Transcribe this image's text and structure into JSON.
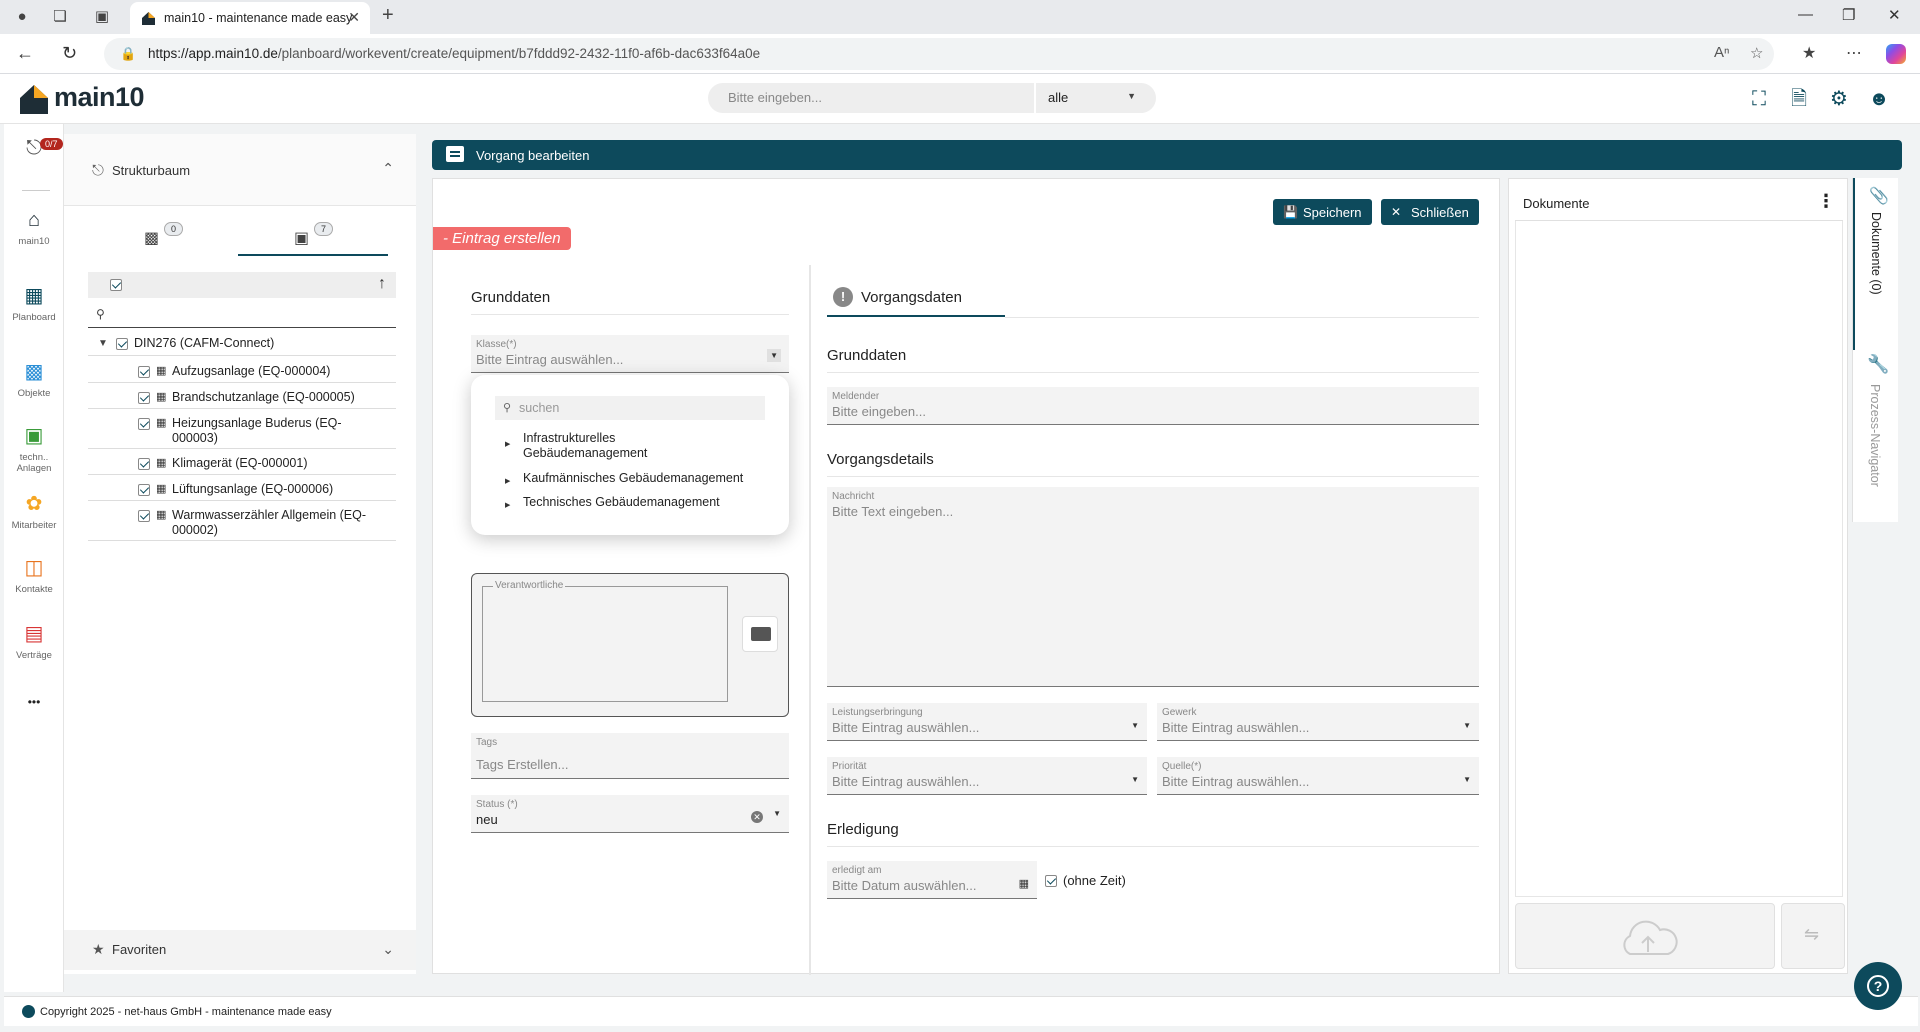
{
  "browser": {
    "tab_title": "main10 - maintenance made easy",
    "url_host": "https://app.main10.de",
    "url_path": "/planboard/workevent/create/equipment/b7fddd92-2432-11f0-af6b-dac633f64a0e"
  },
  "header": {
    "logo_text": "main10",
    "search_placeholder": "Bitte eingeben...",
    "scope_value": "alle"
  },
  "rail": {
    "badge": "0/7",
    "items": [
      {
        "label": "main10"
      },
      {
        "label": "Planboard"
      },
      {
        "label": "Objekte"
      },
      {
        "label": "techn.. Anlagen"
      },
      {
        "label": "Mitarbeiter"
      },
      {
        "label": "Kontakte"
      },
      {
        "label": "Verträge"
      }
    ],
    "more": "•••"
  },
  "structure": {
    "title": "Strukturbaum",
    "tab_buildings_count": "0",
    "tab_equipment_count": "7",
    "root_label": "DIN276 (CAFM-Connect)",
    "items": [
      {
        "label": "Aufzugsanlage (EQ-000004)"
      },
      {
        "label": "Brandschutzanlage (EQ-000005)"
      },
      {
        "label": "Heizungsanlage Buderus (EQ-000003)"
      },
      {
        "label": "Klimagerät (EQ-000001)"
      },
      {
        "label": "Lüftungsanlage (EQ-000006)"
      },
      {
        "label": "Warmwasserzähler Allgemein (EQ-000002)"
      }
    ],
    "favorites": "Favoriten"
  },
  "main": {
    "bar_title": "Vorgang bearbeiten",
    "save_label": "Speichern",
    "close_label": "Schließen",
    "entry_tag": "- Eintrag erstellen",
    "left": {
      "section_title": "Grunddaten",
      "klasse_label": "Klasse(*)",
      "klasse_placeholder": "Bitte Eintrag auswählen...",
      "dropdown": {
        "search_placeholder": "suchen",
        "options": [
          {
            "label": "Infrastrukturelles Gebäudemanagement"
          },
          {
            "label": "Kaufmännisches Gebäudemanagement"
          },
          {
            "label": "Technisches Gebäudemanagement"
          }
        ]
      },
      "responsible_label": "Verantwortliche",
      "tags_label": "Tags",
      "tags_placeholder": "Tags Erstellen...",
      "status_label": "Status (*)",
      "status_value": "neu"
    },
    "right": {
      "tab_title": "Vorgangsdaten",
      "grunddaten_title": "Grunddaten",
      "meldender_label": "Meldender",
      "meldender_placeholder": "Bitte eingeben...",
      "details_title": "Vorgangsdetails",
      "nachricht_label": "Nachricht",
      "nachricht_placeholder": "Bitte Text eingeben...",
      "leistung_label": "Leistungserbringung",
      "gewerk_label": "Gewerk",
      "prioritaet_label": "Priorität",
      "quelle_label": "Quelle(*)",
      "select_placeholder": "Bitte Eintrag auswählen...",
      "erledigung_title": "Erledigung",
      "erledigt_label": "erledigt am",
      "erledigt_placeholder": "Bitte Datum auswählen...",
      "ohne_zeit_label": "(ohne Zeit)"
    }
  },
  "docs": {
    "title": "Dokumente",
    "side_tab_documents": "Dokumente (0)",
    "side_tab_navigator": "Prozess-Navigator"
  },
  "footer": {
    "text": "Copyright 2025 - net-haus GmbH - maintenance made easy"
  },
  "colors": {
    "brand": "#0d4a5c",
    "entry_tag": "#f26b6b",
    "badge": "#b3261e"
  }
}
